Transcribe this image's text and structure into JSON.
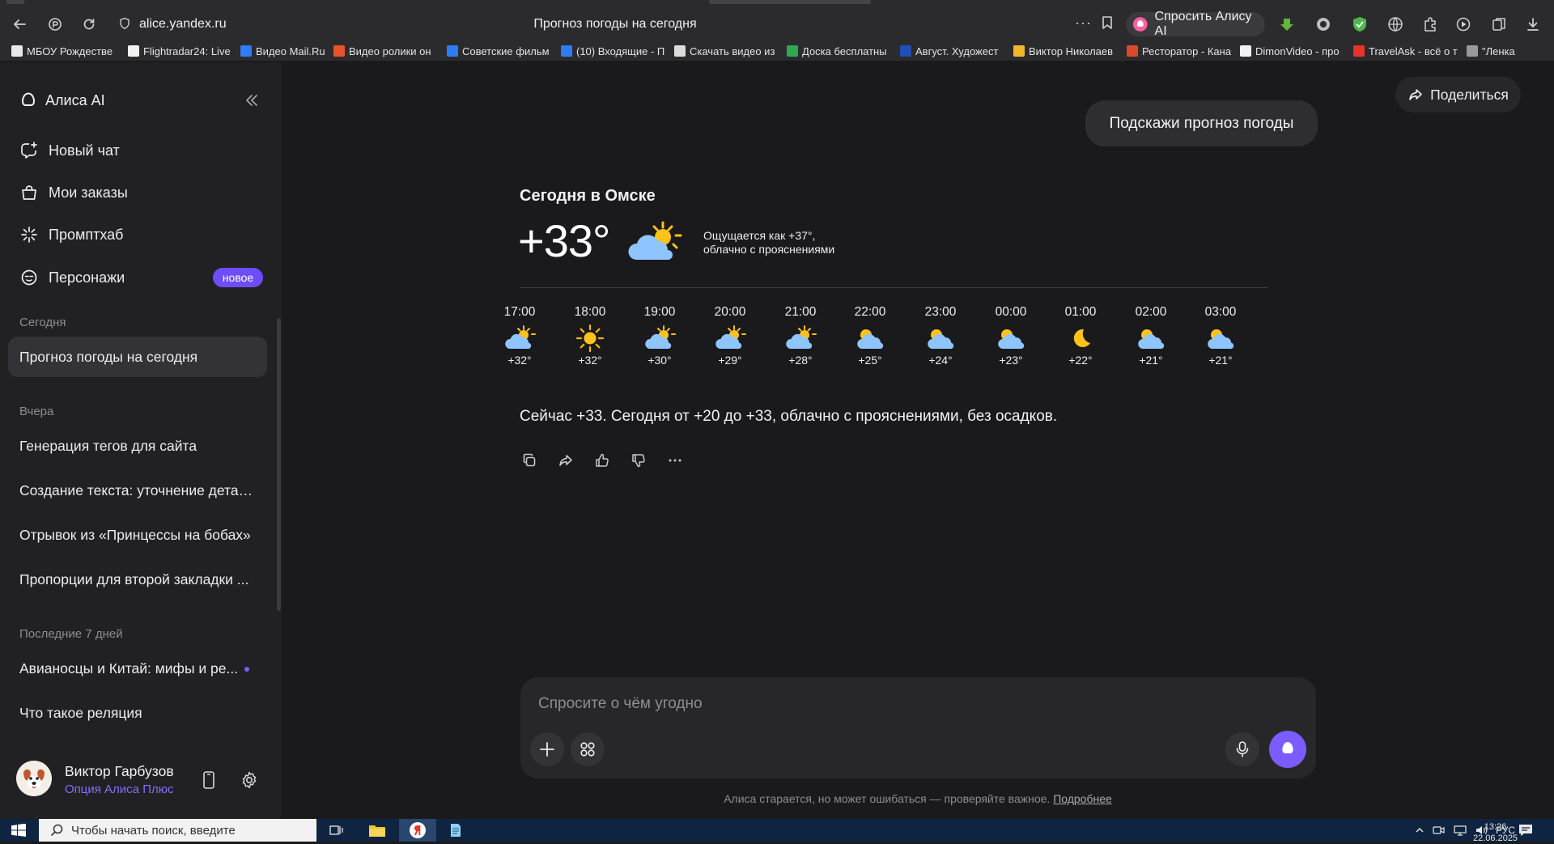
{
  "browser": {
    "url": "alice.yandex.ru",
    "page_title": "Прогноз погоды на сегодня",
    "ask_alice_label": "Спросить Алису AI",
    "more_glyph": "···",
    "bookmarks": [
      {
        "label": "МБОУ Рождестве",
        "color": "#e8e8e8"
      },
      {
        "label": "Flightradar24: Live",
        "color": "#f2f2f2"
      },
      {
        "label": "Видео Mail.Ru",
        "color": "#2f7cf6"
      },
      {
        "label": "Видео ролики он",
        "color": "#e8532b"
      },
      {
        "label": "Советские фильм",
        "color": "#2f7cf6"
      },
      {
        "label": "(10) Входящие - П",
        "color": "#2f7cf6"
      },
      {
        "label": "Скачать видео из",
        "color": "#dcdcdc"
      },
      {
        "label": "Доска бесплатны",
        "color": "#2fa84f"
      },
      {
        "label": "Август. Художест",
        "color": "#1e4fb8"
      },
      {
        "label": "Виктор Николаев",
        "color": "#f2b72b"
      },
      {
        "label": "Ресторатор - Кана",
        "color": "#d94a2b"
      },
      {
        "label": "DimonVideo - про",
        "color": "#f2f2f2"
      },
      {
        "label": "TravelAsk - всё о т",
        "color": "#e8332b"
      },
      {
        "label": "\"Ленка",
        "color": "#9a9a9a"
      }
    ]
  },
  "sidebar": {
    "brand": "Алиса AI",
    "nav": [
      {
        "label": "Новый чат",
        "icon": "new-chat-icon"
      },
      {
        "label": "Мои заказы",
        "icon": "shopping-bag-icon"
      },
      {
        "label": "Промптхаб",
        "icon": "sparkle-icon"
      },
      {
        "label": "Персонажи",
        "icon": "characters-icon"
      }
    ],
    "new_badge": "новое",
    "sections": [
      {
        "title": "Сегодня",
        "chats": [
          "Прогноз погоды на сегодня"
        ]
      },
      {
        "title": "Вчера",
        "chats": [
          "Генерация тегов для сайта",
          "Создание текста: уточнение детал...",
          "Отрывок из «Принцессы на бобах»",
          "Пропорции для второй закладки ..."
        ]
      },
      {
        "title": "Последние 7 дней",
        "chats": [
          "Авианосцы и Китай: мифы и ре...",
          "Что такое реляция"
        ]
      }
    ],
    "user": {
      "name": "Виктор Гарбузов",
      "plan": "Опция Алиса Плюс"
    }
  },
  "main": {
    "share_label": "Поделиться",
    "user_message": "Подскажи прогноз погоды",
    "weather": {
      "title": "Сегодня в Омске",
      "current_temp": "+33°",
      "feels_like": "Ощущается как +37°,",
      "condition": "облачно с прояснениями",
      "hourly": [
        {
          "time": "17:00",
          "temp": "+32°",
          "icon": "partly-cloudy-day-icon"
        },
        {
          "time": "18:00",
          "temp": "+32°",
          "icon": "sun-icon"
        },
        {
          "time": "19:00",
          "temp": "+30°",
          "icon": "partly-cloudy-day-icon"
        },
        {
          "time": "20:00",
          "temp": "+29°",
          "icon": "partly-cloudy-day-icon"
        },
        {
          "time": "21:00",
          "temp": "+28°",
          "icon": "partly-cloudy-day-icon"
        },
        {
          "time": "22:00",
          "temp": "+25°",
          "icon": "cloudy-evening-icon"
        },
        {
          "time": "23:00",
          "temp": "+24°",
          "icon": "cloudy-evening-icon"
        },
        {
          "time": "00:00",
          "temp": "+23°",
          "icon": "cloudy-evening-icon"
        },
        {
          "time": "01:00",
          "temp": "+22°",
          "icon": "moon-icon"
        },
        {
          "time": "02:00",
          "temp": "+21°",
          "icon": "cloudy-evening-icon"
        },
        {
          "time": "03:00",
          "temp": "+21°",
          "icon": "cloudy-evening-icon"
        }
      ],
      "summary": "Сейчас +33. Сегодня от +20 до +33, облачно с прояснениями, без осадков."
    },
    "composer": {
      "placeholder": "Спросите о чём угодно"
    },
    "disclaimer_text": "Алиса старается, но может ошибаться — проверяйте важное.",
    "disclaimer_link": "Подробнее"
  },
  "taskbar": {
    "search_placeholder": "Чтобы начать поиск, введите",
    "language": "РУС",
    "time": "13:26",
    "date": "22.06.2025"
  },
  "colors": {
    "accent": "#7a5cff",
    "badge": "#6d4dff",
    "background": "#1a1a1c",
    "sidebar": "#212124"
  }
}
